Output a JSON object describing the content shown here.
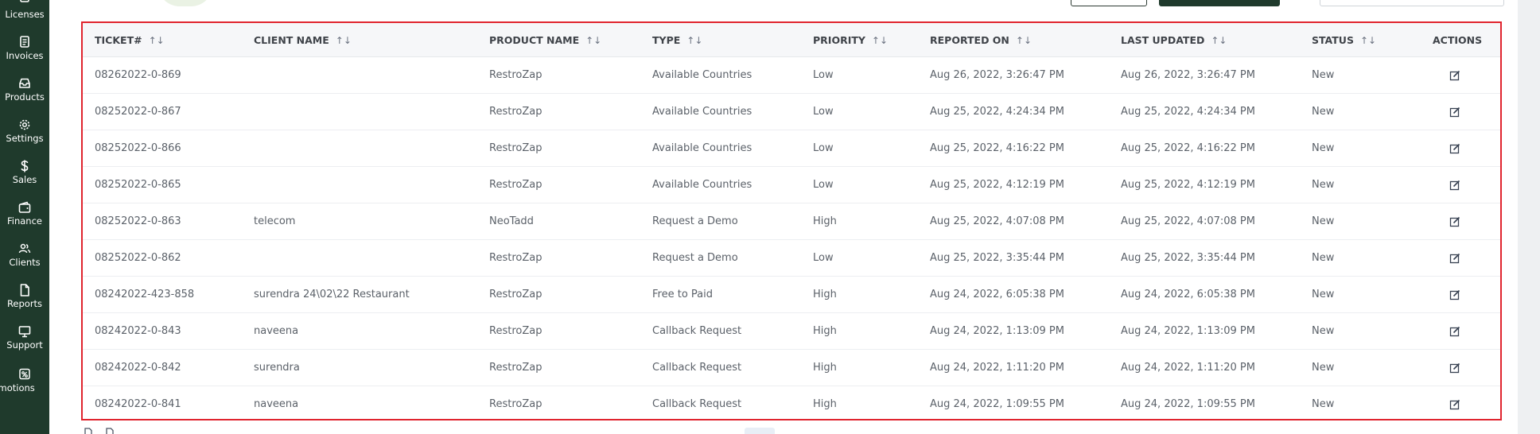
{
  "sidebar": {
    "items": [
      {
        "label": "Licenses",
        "icon": "license-icon"
      },
      {
        "label": "Invoices",
        "icon": "invoice-icon"
      },
      {
        "label": "Products",
        "icon": "inbox-icon"
      },
      {
        "label": "Settings",
        "icon": "gear-icon"
      },
      {
        "label": "Sales",
        "icon": "dollar-icon"
      },
      {
        "label": "Finance",
        "icon": "wallet-icon"
      },
      {
        "label": "Clients",
        "icon": "users-icon"
      },
      {
        "label": "Reports",
        "icon": "file-icon"
      },
      {
        "label": "Support",
        "icon": "monitor-icon"
      },
      {
        "label": "romotions",
        "icon": "promotion-icon"
      }
    ]
  },
  "table": {
    "columns": {
      "ticket": "TICKET#",
      "client": "CLIENT NAME",
      "product": "PRODUCT NAME",
      "type": "TYPE",
      "priority": "PRIORITY",
      "reported": "REPORTED ON",
      "updated": "LAST UPDATED",
      "status": "STATUS",
      "actions": "ACTIONS"
    },
    "sort_icon": "↑↓",
    "rows": [
      {
        "ticket": "08262022-0-869",
        "client": "",
        "product": "RestroZap",
        "type": "Available Countries",
        "priority": "Low",
        "reported": "Aug 26, 2022, 3:26:47 PM",
        "updated": "Aug 26, 2022, 3:26:47 PM",
        "status": "New"
      },
      {
        "ticket": "08252022-0-867",
        "client": "",
        "product": "RestroZap",
        "type": "Available Countries",
        "priority": "Low",
        "reported": "Aug 25, 2022, 4:24:34 PM",
        "updated": "Aug 25, 2022, 4:24:34 PM",
        "status": "New"
      },
      {
        "ticket": "08252022-0-866",
        "client": "",
        "product": "RestroZap",
        "type": "Available Countries",
        "priority": "Low",
        "reported": "Aug 25, 2022, 4:16:22 PM",
        "updated": "Aug 25, 2022, 4:16:22 PM",
        "status": "New"
      },
      {
        "ticket": "08252022-0-865",
        "client": "",
        "product": "RestroZap",
        "type": "Available Countries",
        "priority": "Low",
        "reported": "Aug 25, 2022, 4:12:19 PM",
        "updated": "Aug 25, 2022, 4:12:19 PM",
        "status": "New"
      },
      {
        "ticket": "08252022-0-863",
        "client": "telecom",
        "product": "NeoTadd",
        "type": "Request a Demo",
        "priority": "High",
        "reported": "Aug 25, 2022, 4:07:08 PM",
        "updated": "Aug 25, 2022, 4:07:08 PM",
        "status": "New"
      },
      {
        "ticket": "08252022-0-862",
        "client": "",
        "product": "RestroZap",
        "type": "Request a Demo",
        "priority": "Low",
        "reported": "Aug 25, 2022, 3:35:44 PM",
        "updated": "Aug 25, 2022, 3:35:44 PM",
        "status": "New"
      },
      {
        "ticket": "08242022-423-858",
        "client": "surendra 24\\02\\22 Restaurant",
        "product": "RestroZap",
        "type": "Free to Paid",
        "priority": "High",
        "reported": "Aug 24, 2022, 6:05:38 PM",
        "updated": "Aug 24, 2022, 6:05:38 PM",
        "status": "New"
      },
      {
        "ticket": "08242022-0-843",
        "client": "naveena",
        "product": "RestroZap",
        "type": "Callback Request",
        "priority": "High",
        "reported": "Aug 24, 2022, 1:13:09 PM",
        "updated": "Aug 24, 2022, 1:13:09 PM",
        "status": "New"
      },
      {
        "ticket": "08242022-0-842",
        "client": "surendra",
        "product": "RestroZap",
        "type": "Callback Request",
        "priority": "High",
        "reported": "Aug 24, 2022, 1:11:20 PM",
        "updated": "Aug 24, 2022, 1:11:20 PM",
        "status": "New"
      },
      {
        "ticket": "08242022-0-841",
        "client": "naveena",
        "product": "RestroZap",
        "type": "Callback Request",
        "priority": "High",
        "reported": "Aug 24, 2022, 1:09:55 PM",
        "updated": "Aug 24, 2022, 1:09:55 PM",
        "status": "New"
      }
    ]
  },
  "colors": {
    "sidebar_bg": "#1f3a2c",
    "highlight_border": "#e0242e",
    "header_bg": "#f6f7f9"
  }
}
